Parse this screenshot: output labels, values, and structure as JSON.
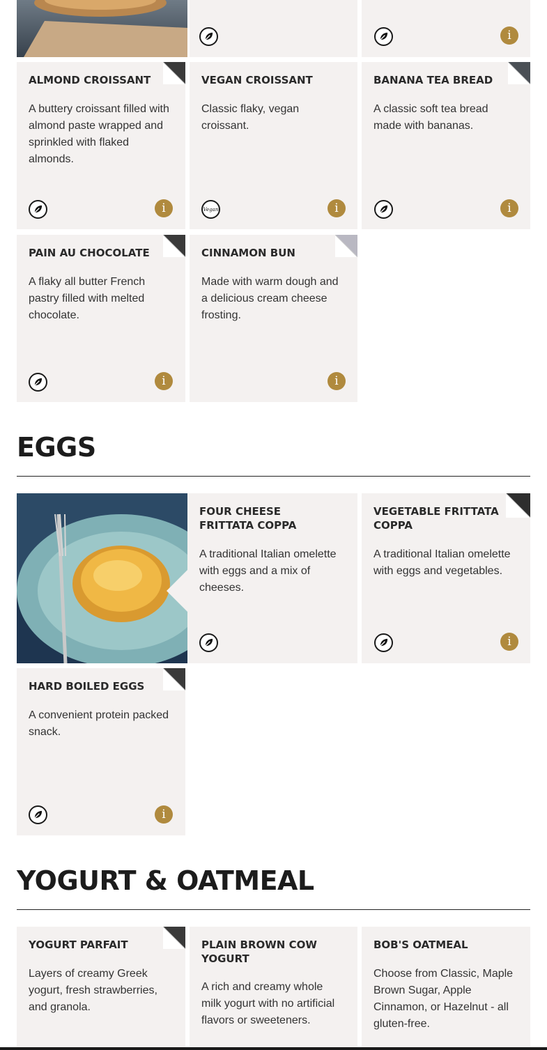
{
  "sections": {
    "eggs": {
      "title": "EGGS"
    },
    "yogurt": {
      "title": "YOGURT & OATMEAL"
    }
  },
  "cards": {
    "almond": {
      "title": "ALMOND CROISSANT",
      "desc": "A buttery croissant filled with almond paste wrapped and sprinkled with flaked almonds."
    },
    "vegan": {
      "title": "VEGAN CROISSANT",
      "desc": "Classic flaky, vegan croissant."
    },
    "banana": {
      "title": "BANANA TEA BREAD",
      "desc": "A classic soft tea bread made with bananas."
    },
    "pain": {
      "title": "PAIN AU CHOCOLATE",
      "desc": "A flaky all butter French pastry filled with melted chocolate."
    },
    "cinnamon": {
      "title": "CINNAMON BUN",
      "desc": "Made with warm dough and a delicious cream cheese frosting."
    },
    "four_cheese": {
      "title": "FOUR CHEESE FRITTATA COPPA",
      "desc": "A traditional Italian omelette with eggs and a mix of cheeses."
    },
    "veg_frittata": {
      "title": "VEGETABLE FRITTATA COPPA",
      "desc": "A traditional Italian omelette with eggs and vegetables."
    },
    "hard_boiled": {
      "title": "HARD BOILED EGGS",
      "desc": "A convenient protein packed snack."
    },
    "parfait": {
      "title": "YOGURT PARFAIT",
      "desc": "Layers of creamy Greek yogurt, fresh strawberries, and granola."
    },
    "brown_cow": {
      "title": "PLAIN BROWN COW YOGURT",
      "desc": "A rich and creamy whole milk yogurt with no artificial flavors or sweeteners."
    },
    "oatmeal": {
      "title": "BOB'S OATMEAL",
      "desc": "Choose from Classic, Maple Brown Sugar, Apple Cinnamon, or Hazelnut - all gluten-free."
    }
  },
  "icons": {
    "leaf": "leaf-icon",
    "vegan": "vegan-icon",
    "vegan_label": "Vegan",
    "info": "info-icon",
    "info_glyph": "i"
  },
  "colors": {
    "card_bg": "#f4f1f0",
    "accent": "#b08a3e",
    "text": "#2b2b2b"
  }
}
